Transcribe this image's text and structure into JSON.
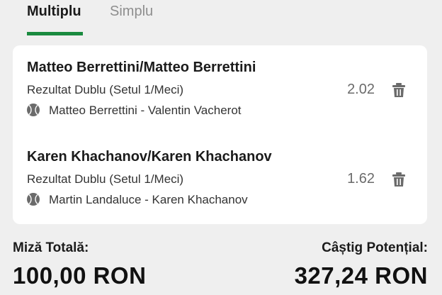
{
  "tabs": {
    "multiplu": "Multiplu",
    "simplu": "Simplu"
  },
  "bets": [
    {
      "title": "Matteo Berrettini/Matteo Berrettini",
      "market": "Rezultat Dublu (Setul 1/Meci)",
      "odds": "2.02",
      "event": "Matteo Berrettini - Valentin Vacherot"
    },
    {
      "title": "Karen Khachanov/Karen Khachanov",
      "market": "Rezultat Dublu (Setul 1/Meci)",
      "odds": "1.62",
      "event": "Martin Landaluce - Karen Khachanov"
    }
  ],
  "footer": {
    "stake_label": "Miză Totală:",
    "stake_value": "100,00 RON",
    "win_label": "Câștig Potențial:",
    "win_value": "327,24 RON"
  },
  "colors": {
    "accent": "#1a8a3f",
    "background": "#efefef",
    "card": "#ffffff"
  },
  "icons": {
    "delete": "trash-icon",
    "sport": "tennis-ball-icon"
  }
}
